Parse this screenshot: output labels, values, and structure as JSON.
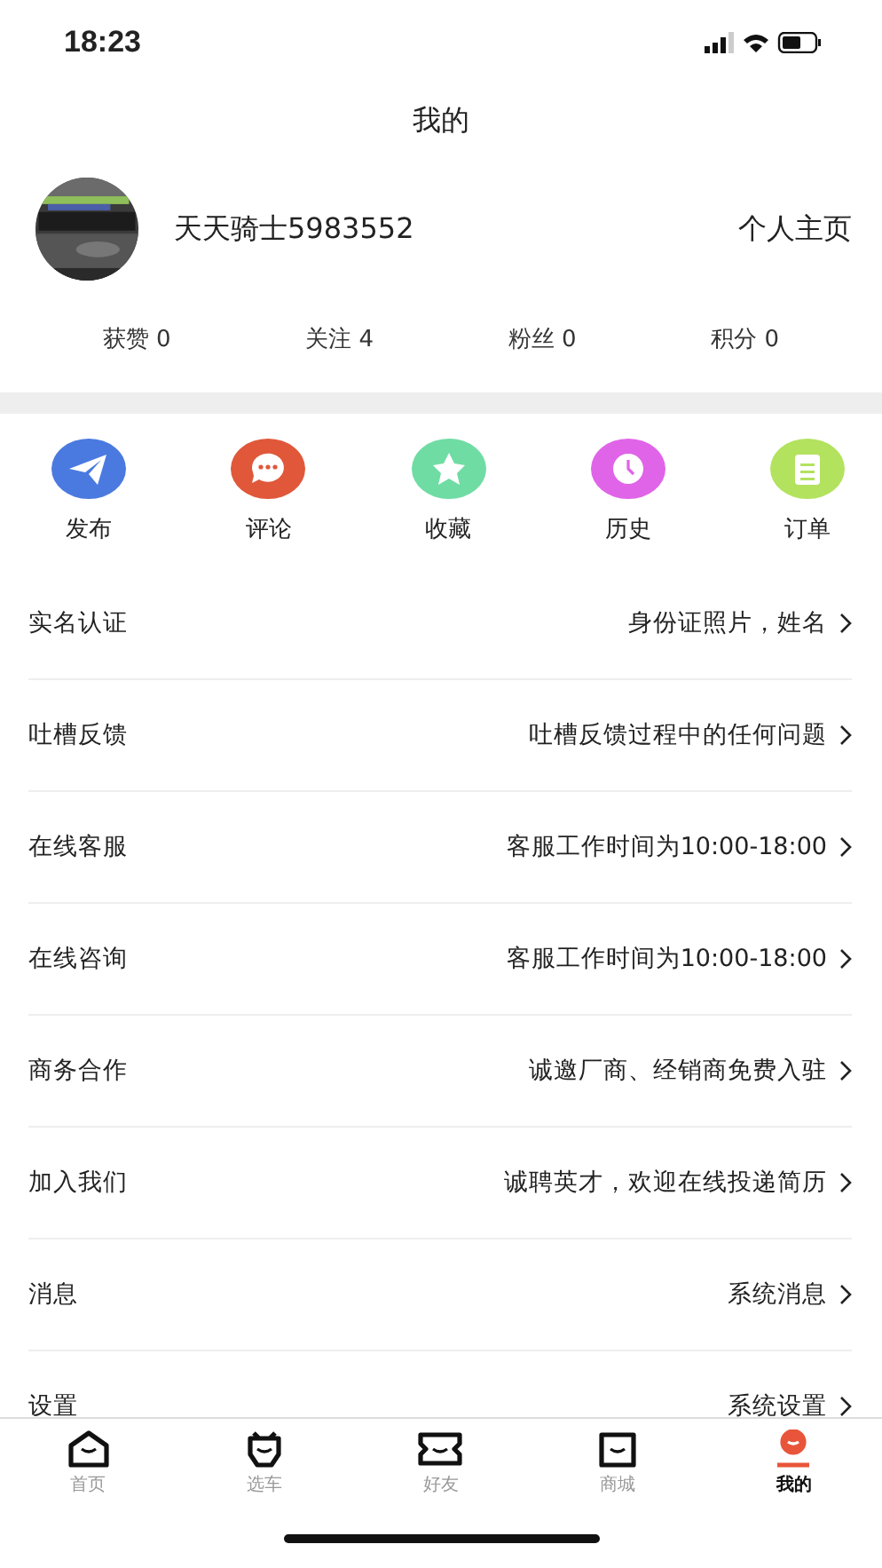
{
  "status_bar": {
    "time": "18:23"
  },
  "header": {
    "title": "我的"
  },
  "profile": {
    "name": "天天骑士5983552",
    "link": "个人主页"
  },
  "stats": [
    {
      "label": "获赞 0"
    },
    {
      "label": "关注 4"
    },
    {
      "label": "粉丝 0"
    },
    {
      "label": "积分 0"
    }
  ],
  "shortcuts": [
    {
      "label": "发布",
      "color": "#4a7ae0"
    },
    {
      "label": "评论",
      "color": "#e0573a"
    },
    {
      "label": "收藏",
      "color": "#6fdca4"
    },
    {
      "label": "历史",
      "color": "#e064e8"
    },
    {
      "label": "订单",
      "color": "#b3e25e"
    }
  ],
  "menu": [
    {
      "label": "实名认证",
      "detail": "身份证照片，姓名"
    },
    {
      "label": "吐槽反馈",
      "detail": "吐槽反馈过程中的任何问题"
    },
    {
      "label": "在线客服",
      "detail": "客服工作时间为10:00-18:00"
    },
    {
      "label": "在线咨询",
      "detail": "客服工作时间为10:00-18:00"
    },
    {
      "label": "商务合作",
      "detail": "诚邀厂商、经销商免费入驻"
    },
    {
      "label": "加入我们",
      "detail": "诚聘英才，欢迎在线投递简历"
    },
    {
      "label": "消息",
      "detail": "系统消息"
    },
    {
      "label": "设置",
      "detail": "系统设置"
    }
  ],
  "tab_bar": [
    {
      "label": "首页",
      "selected": false
    },
    {
      "label": "选车",
      "selected": false
    },
    {
      "label": "好友",
      "selected": false
    },
    {
      "label": "商城",
      "selected": false
    },
    {
      "label": "我的",
      "selected": true
    }
  ]
}
